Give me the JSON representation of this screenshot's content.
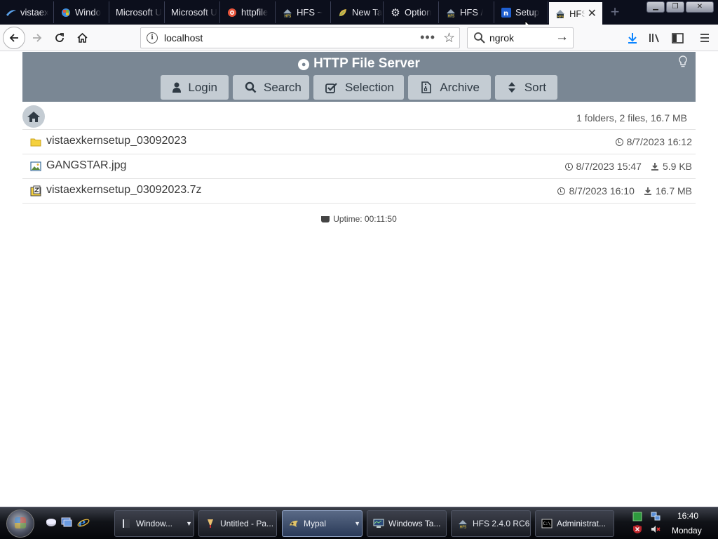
{
  "browser": {
    "tabs": [
      {
        "label": "vistaex",
        "icon": "vista-logo-icon",
        "active": false
      },
      {
        "label": "Windo",
        "icon": "vista-globe-icon",
        "active": false
      },
      {
        "label": "Microsoft U",
        "icon": "",
        "active": false
      },
      {
        "label": "Microsoft U",
        "icon": "",
        "active": false
      },
      {
        "label": "httpfile",
        "icon": "target-icon",
        "active": false
      },
      {
        "label": "HFS ~",
        "icon": "hfs-icon",
        "active": false
      },
      {
        "label": "New Ta",
        "icon": "leaf-icon",
        "active": false
      },
      {
        "label": "Option",
        "icon": "gear-icon",
        "active": false
      },
      {
        "label": "HFS /",
        "icon": "hfs-icon",
        "active": false
      },
      {
        "label": "Setup",
        "icon": "ngrok-icon",
        "active": false
      },
      {
        "label": "HFS",
        "icon": "hfs-icon",
        "active": true
      }
    ],
    "url": "localhost",
    "search_value": "ngrok"
  },
  "hfs": {
    "title": "HTTP File Server",
    "buttons": {
      "login": "Login",
      "search": "Search",
      "selection": "Selection",
      "archive": "Archive",
      "sort": "Sort"
    },
    "summary": "1 folders, 2 files, 16.7 MB",
    "files": [
      {
        "name": "vistaex​kernsetup_03092023",
        "type": "folder",
        "date": "8/7/2023 16:12",
        "size": ""
      },
      {
        "name": "GANGSTAR.jpg",
        "type": "image",
        "date": "8/7/2023 15:47",
        "size": "5.9 KB"
      },
      {
        "name": "vistaexkernsetup_03092023.7z",
        "type": "archive",
        "date": "8/7/2023 16:10",
        "size": "16.7 MB"
      }
    ],
    "uptime": "Uptime: 00:11:50"
  },
  "taskbar": {
    "tasks": [
      {
        "label": "Window...",
        "icon": "folder-icon",
        "active": false
      },
      {
        "label": "Untitled - Pa...",
        "icon": "paint-icon",
        "active": false
      },
      {
        "label": "Mypal",
        "icon": "mypal-icon",
        "active": true
      },
      {
        "label": "Windows Ta...",
        "icon": "task-manager-icon",
        "active": false
      },
      {
        "label": "HFS 2.4.0 RC6",
        "icon": "hfs-icon",
        "active": false
      },
      {
        "label": "Administrat...",
        "icon": "cmd-icon",
        "active": false
      }
    ],
    "time": "16:40",
    "day": "Monday"
  }
}
